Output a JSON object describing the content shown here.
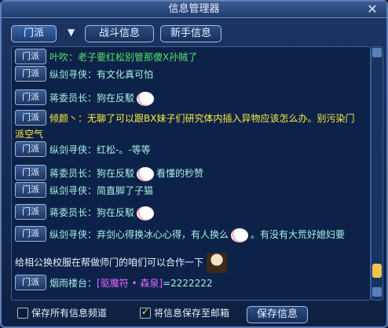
{
  "window": {
    "title": "信息管理器"
  },
  "tabs": [
    {
      "label": "门派",
      "active": true
    },
    {
      "label": "战斗信息",
      "active": false
    },
    {
      "label": "新手信息",
      "active": false
    }
  ],
  "messages": [
    {
      "channel": "门派",
      "speaker": "叶吹：",
      "text": "老子要红松别管那傻X孙贼了",
      "color": "green"
    },
    {
      "channel": "门派",
      "speaker": "纵剑寻侠：",
      "text": "有文化真可怕",
      "color": "cyan"
    },
    {
      "channel": "门派",
      "speaker": "蒋委员长：",
      "text": "狗在反駁",
      "color": "cyan",
      "emojis": 1
    },
    {
      "channel": "门派",
      "speaker": "倾颜丶：",
      "text": "无聊了可以跟BX妹子们研究体内插入异物应该怎么办。别污染门",
      "color": "yellow"
    },
    {
      "channel": "",
      "speaker": "",
      "text": "派空气",
      "color": "yellow"
    },
    {
      "channel": "门派",
      "speaker": "纵剑寻侠：",
      "text": "红松-。-等等",
      "color": "cyan"
    },
    {
      "channel": "门派",
      "speaker": "蒋委员长：",
      "text": "狗在反駁",
      "color": "cyan",
      "emojis": 1,
      "after": "看懂的秒赞"
    },
    {
      "channel": "门派",
      "speaker": "纵剑寻侠：",
      "text": "简直脚了子猫",
      "color": "cyan"
    },
    {
      "channel": "门派",
      "speaker": "蒋委员长：",
      "text": "狗在反駁",
      "color": "cyan",
      "emojis": 1
    },
    {
      "channel": "门派",
      "speaker": "纵剑寻侠：",
      "text": "弃剑心得换冰心心得，有人换么",
      "color": "cyan",
      "emojis": 1,
      "after": "。有没有大荒好媳妇要"
    },
    {
      "channel": "",
      "speaker": "",
      "text": "给相公换校服在帮做师门的咱们可以合作一下",
      "color": "white",
      "bigicon": true
    },
    {
      "channel": "门派",
      "speaker": "烟雨楼台：",
      "text": "[驱魔符 • 森泉]=2222222",
      "color": "cyan"
    }
  ],
  "footer": {
    "save_all_label": "保存所有信息频道",
    "save_all_checked": false,
    "save_mail_label": "将信息保存至邮箱",
    "save_mail_checked": true,
    "save_button_label": "保存信息"
  }
}
